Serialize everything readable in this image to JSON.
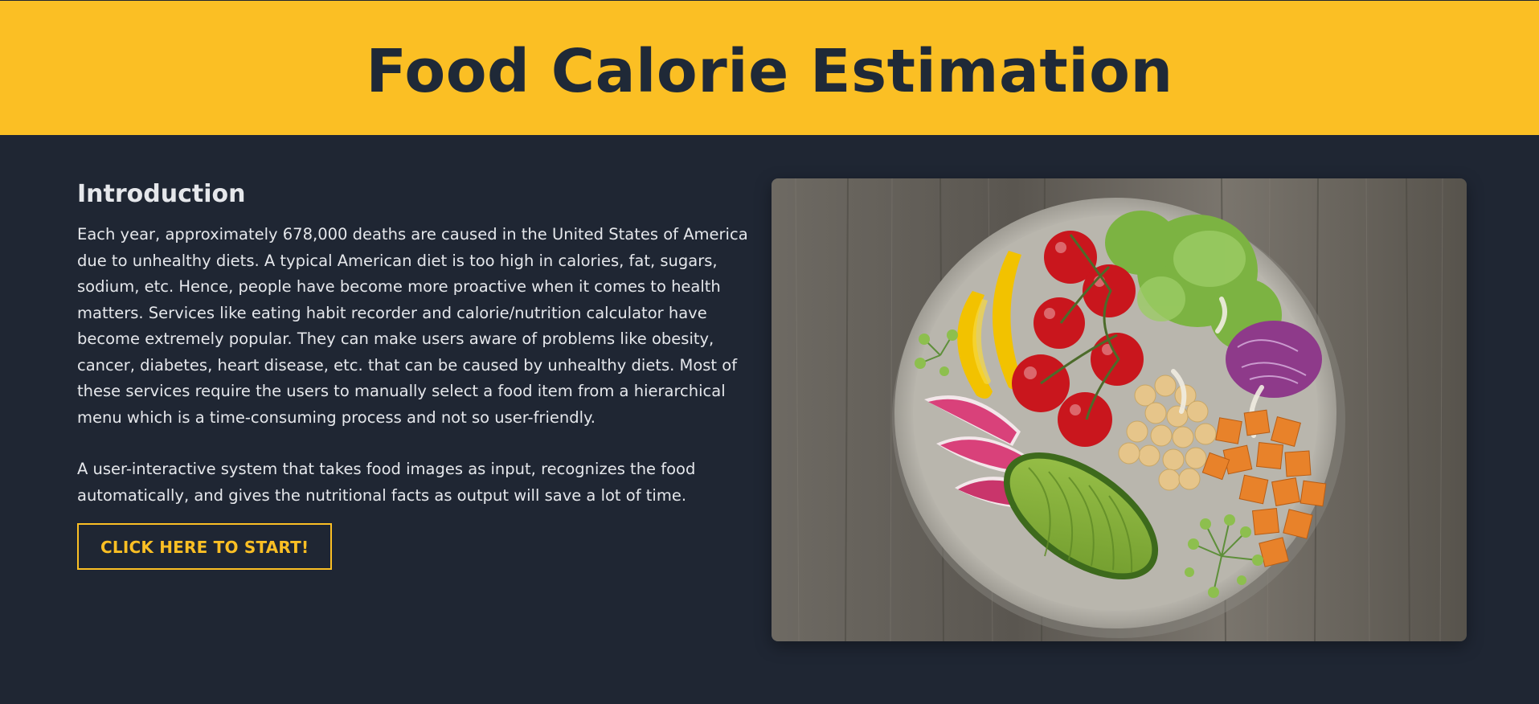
{
  "header": {
    "title": "Food Calorie Estimation"
  },
  "intro": {
    "heading": "Introduction",
    "paragraphs": [
      "Each year, approximately 678,000 deaths are caused in the United States of America due to unhealthy diets. A typical American diet is too high in calories, fat, sugars, sodium, etc. Hence, people have become more proactive when it comes to health matters. Services like eating habit recorder and calorie/nutrition calculator have become extremely popular. They can make users aware of problems like obesity, cancer, diabetes, heart disease, etc. that can be caused by unhealthy diets. Most of these services require the users to manually select a food item from a hierarchical menu which is a time-consuming process and not so user-friendly.",
      "A user-interactive system that takes food images as input, recognizes the food automatically, and gives the nutritional facts as output will save a lot of time."
    ],
    "cta_label": "CLICK HERE TO START!"
  },
  "colors": {
    "accent": "#fbbf24",
    "background": "#1f2633",
    "header_text": "#1f2937",
    "body_text": "#e5e7eb"
  }
}
